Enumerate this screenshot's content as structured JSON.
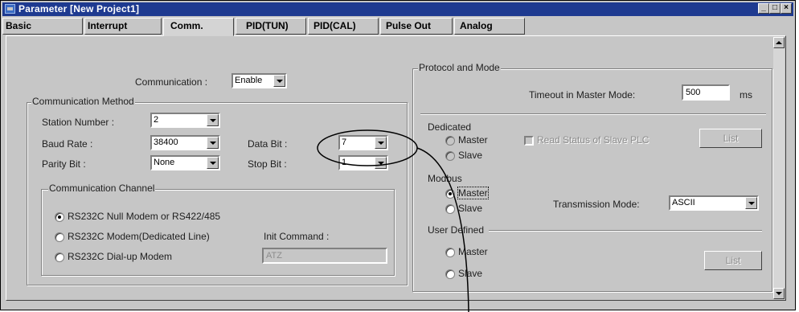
{
  "window": {
    "title": "Parameter [New Project1]",
    "buttons": [
      "_",
      "□",
      "×"
    ]
  },
  "tabs": [
    "Basic",
    "Interrupt",
    "Comm.",
    "PID(TUN)",
    "PID(CAL)",
    "Pulse Out",
    "Analog"
  ],
  "active_tab": "Comm.",
  "left": {
    "communication_label": "Communication :",
    "communication_value": "Enable",
    "method_title": "Communication Method",
    "station_label": "Station Number :",
    "station_value": "2",
    "baud_label": "Baud Rate :",
    "baud_value": "38400",
    "databit_label": "Data Bit :",
    "databit_value": "7",
    "parity_label": "Parity Bit :",
    "parity_value": "None",
    "stopbit_label": "Stop Bit :",
    "stopbit_value": "1",
    "channel_title": "Communication Channel",
    "channel_options": [
      "RS232C Null Modem or RS422/485",
      "RS232C Modem(Dedicated Line)",
      "RS232C Dial-up Modem"
    ],
    "channel_selected": 0,
    "init_label": "Init Command :",
    "init_value": "ATZ"
  },
  "right": {
    "protocol_title": "Protocol and Mode",
    "timeout_label": "Timeout in Master Mode:",
    "timeout_value": "500",
    "timeout_unit": "ms",
    "dedicated_label": "Dedicated",
    "dedicated_master": "Master",
    "dedicated_slave": "Slave",
    "read_status_label": "Read Status of Slave PLC",
    "list_label": "List",
    "modbus_label": "Modbus",
    "modbus_master": "Master",
    "modbus_slave": "Slave",
    "transmission_label": "Transmission Mode:",
    "transmission_value": "ASCII",
    "user_label": "User Defined",
    "user_master": "Master",
    "user_slave": "Slave",
    "user_list_label": "List"
  }
}
